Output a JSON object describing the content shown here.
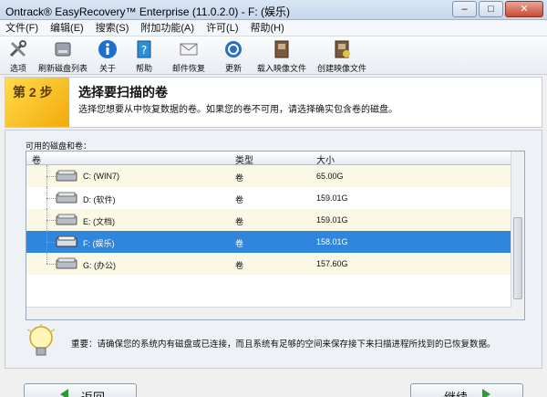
{
  "window": {
    "title": "Ontrack® EasyRecovery™ Enterprise (11.0.2.0) - F: (娱乐)"
  },
  "menu": [
    "文件(F)",
    "编辑(E)",
    "搜索(S)",
    "附加功能(A)",
    "许可(L)",
    "帮助(H)"
  ],
  "toolbar": [
    {
      "label": "选项",
      "icon": "tools-icon"
    },
    {
      "label": "刷新磁盘列表",
      "icon": "refresh-disk-icon"
    },
    {
      "label": "关于",
      "icon": "info-icon"
    },
    {
      "label": "帮助",
      "icon": "help-book-icon"
    },
    {
      "label": "邮件恢复",
      "icon": "mail-icon"
    },
    {
      "label": "更新",
      "icon": "update-icon"
    },
    {
      "label": "载入映像文件",
      "icon": "load-image-icon"
    },
    {
      "label": "创建映像文件",
      "icon": "create-image-icon"
    }
  ],
  "step": {
    "number": "第 2 步",
    "title": "选择要扫描的卷",
    "description": "选择您想要从中恢复数据的卷。如果您的卷不可用，请选择确实包含卷的磁盘。"
  },
  "volumes": {
    "caption": "可用的磁盘和卷：",
    "columns": [
      "卷",
      "类型",
      "大小"
    ],
    "rows": [
      {
        "name": "C: (WIN7)",
        "type": "卷",
        "size": "65.00G",
        "selected": false
      },
      {
        "name": "D: (软件)",
        "type": "卷",
        "size": "159.01G",
        "selected": false
      },
      {
        "name": "E: (文档)",
        "type": "卷",
        "size": "159.01G",
        "selected": false
      },
      {
        "name": "F: (娱乐)",
        "type": "卷",
        "size": "158.01G",
        "selected": true
      },
      {
        "name": "G: (办公)",
        "type": "卷",
        "size": "157.60G",
        "selected": false
      }
    ]
  },
  "notice": {
    "text": "重要：请确保您的系统内有磁盘或已连接，而且系统有足够的空间来保存接下来扫描进程所找到的已恢复数据。"
  },
  "buttons": {
    "back": "返回",
    "next": "继续"
  },
  "colors": {
    "selection": "#2f86dc",
    "step_accent": "#f3a90c",
    "arrow": "#2f9a33"
  }
}
